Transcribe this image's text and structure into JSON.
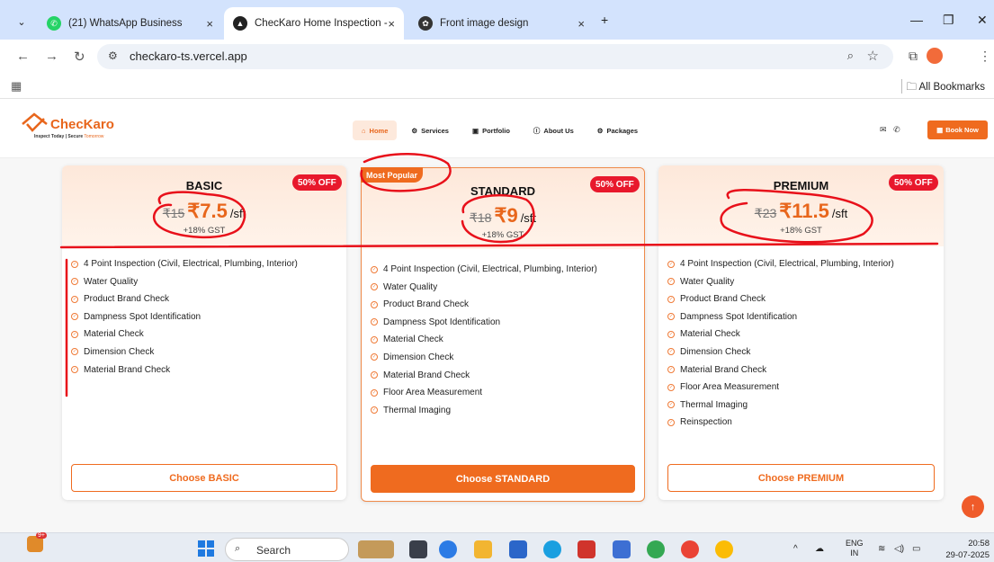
{
  "browser": {
    "tabs": [
      {
        "title": "(21) WhatsApp Business",
        "active": false
      },
      {
        "title": "ChecKaro Home Inspection - In",
        "active": true
      },
      {
        "title": "Front image design",
        "active": false
      }
    ],
    "url": "checkaro-ts.vercel.app",
    "bookmarks_label": "All Bookmarks"
  },
  "site": {
    "brand": "ChecKaro",
    "tagline_a": "Inspect Today | Secure",
    "tagline_b": "Tomorrow",
    "nav": [
      {
        "label": "Home",
        "icon": "home-icon",
        "active": true
      },
      {
        "label": "Services",
        "icon": "gear-icon",
        "active": false
      },
      {
        "label": "Portfolio",
        "icon": "portfolio-icon",
        "active": false
      },
      {
        "label": "About Us",
        "icon": "info-icon",
        "active": false
      },
      {
        "label": "Packages",
        "icon": "package-icon",
        "active": false
      }
    ],
    "book_now": "Book Now",
    "brand_color": "#e8661c"
  },
  "plans": [
    {
      "name": "BASIC",
      "discount": "50% OFF",
      "old_price": "₹15",
      "price": "₹7.5",
      "unit": "/sft",
      "gst": "+18% GST",
      "features": [
        "4 Point Inspection (Civil, Electrical, Plumbing, Interior)",
        "Water Quality",
        "Product Brand Check",
        "Dampness Spot Identification",
        "Material Check",
        "Dimension Check",
        "Material Brand Check"
      ],
      "cta": "Choose BASIC"
    },
    {
      "name": "STANDARD",
      "badge": "Most Popular",
      "discount": "50% OFF",
      "old_price": "₹18",
      "price": "₹9",
      "unit": "/sft",
      "gst": "+18% GST",
      "features": [
        "4 Point Inspection (Civil, Electrical, Plumbing, Interior)",
        "Water Quality",
        "Product Brand Check",
        "Dampness Spot Identification",
        "Material Check",
        "Dimension Check",
        "Material Brand Check",
        "Floor Area Measurement",
        "Thermal Imaging"
      ],
      "cta": "Choose STANDARD"
    },
    {
      "name": "PREMIUM",
      "discount": "50% OFF",
      "old_price": "₹23",
      "price": "₹11.5",
      "unit": "/sft",
      "gst": "+18% GST",
      "features": [
        "4 Point Inspection (Civil, Electrical, Plumbing, Interior)",
        "Water Quality",
        "Product Brand Check",
        "Dampness Spot Identification",
        "Material Check",
        "Dimension Check",
        "Material Brand Check",
        "Floor Area Measurement",
        "Thermal Imaging",
        "Reinspection"
      ],
      "cta": "Choose PREMIUM"
    }
  ],
  "taskbar": {
    "search_placeholder": "Search",
    "notification_count": "9+",
    "lang_line1": "ENG",
    "lang_line2": "IN",
    "time": "20:58",
    "date": "29-07-2025"
  }
}
